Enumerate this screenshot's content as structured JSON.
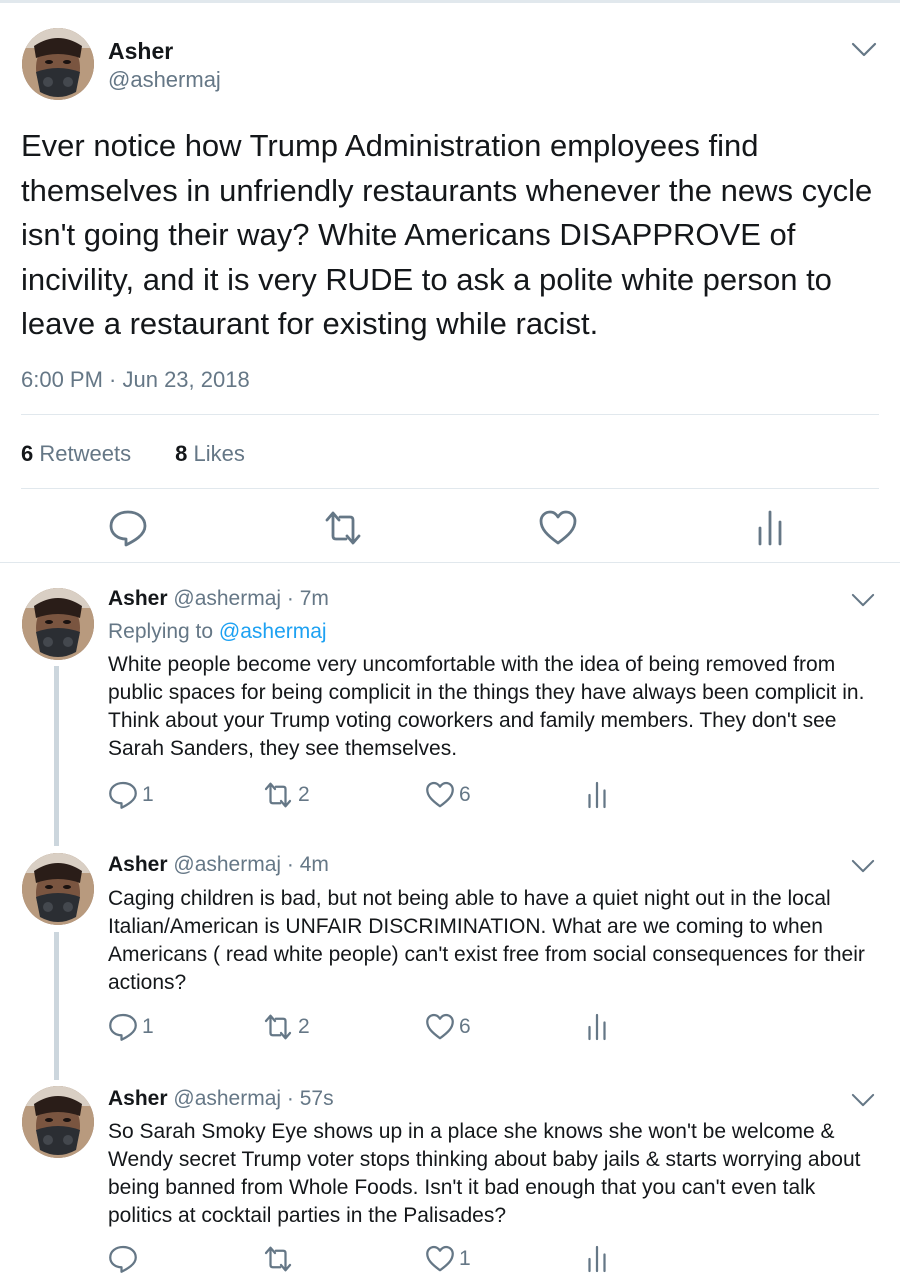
{
  "main_tweet": {
    "name": "Asher",
    "handle": "@ashermaj",
    "text": "Ever notice how Trump Administration employees find themselves in unfriendly restaurants whenever the news cycle isn't going their way? White Americans DISAPPROVE of incivility, and it is very RUDE to ask a polite white person to leave a restaurant for existing while racist.",
    "timestamp": "6:00 PM · Jun 23, 2018",
    "retweets_count": "6",
    "retweets_label": "Retweets",
    "likes_count": "8",
    "likes_label": "Likes",
    "icons": [
      "reply-icon",
      "retweet-icon",
      "like-icon",
      "analytics-icon",
      "chevron-down-icon"
    ]
  },
  "replies": [
    {
      "name": "Asher",
      "handle": "@ashermaj",
      "time": "· 7m",
      "replying_prefix": "Replying to",
      "replying_to": "@ashermaj",
      "text": "White people become very uncomfortable with the idea of being removed from public spaces for being complicit in the things they have always been complicit in. Think about your Trump voting coworkers and family members. They don't see Sarah Sanders, they see themselves.",
      "reply_count": "1",
      "retweet_count": "2",
      "like_count": "6"
    },
    {
      "name": "Asher",
      "handle": "@ashermaj",
      "time": "· 4m",
      "text": "Caging children is bad, but not being able to have a quiet night out in the local Italian/American is UNFAIR DISCRIMINATION. What are we coming to when Americans ( read white people) can't exist free from social consequences for their actions?",
      "reply_count": "1",
      "retweet_count": "2",
      "like_count": "6"
    },
    {
      "name": "Asher",
      "handle": "@ashermaj",
      "time": "· 57s",
      "text": "So Sarah Smoky Eye shows up in a place she knows she won't be welcome & Wendy secret Trump voter stops thinking about baby jails & starts worrying about being banned from Whole Foods. Isn't it bad enough that you can't even talk politics at cocktail parties in the Palisades?",
      "reply_count": "",
      "retweet_count": "",
      "like_count": "1"
    }
  ],
  "colors": {
    "text": "#14171a",
    "secondary": "#657786",
    "link": "#1da1f2",
    "border": "#e1e8ed",
    "thread_line": "#ccd6dd"
  }
}
